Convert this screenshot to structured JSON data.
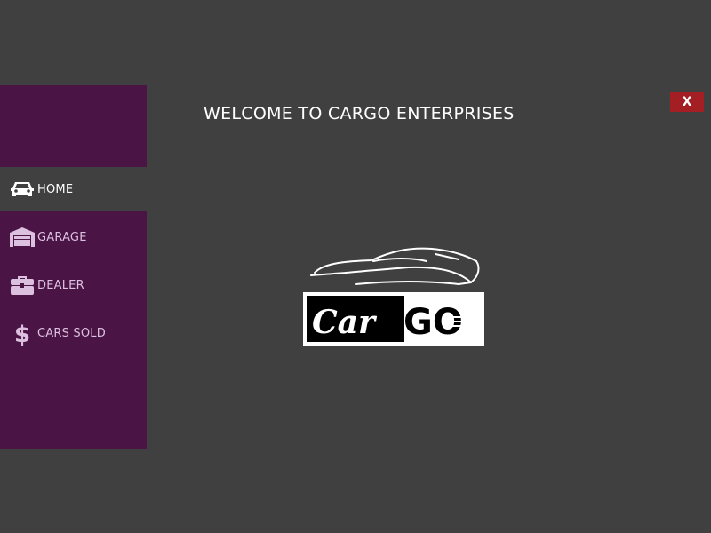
{
  "window": {
    "close_label": "X"
  },
  "header": {
    "title": "WELCOME TO CARGO ENTERPRISES"
  },
  "sidebar": {
    "items": [
      {
        "label": "HOME",
        "icon": "car-icon",
        "active": true
      },
      {
        "label": "GARAGE",
        "icon": "garage-icon",
        "active": false
      },
      {
        "label": "DEALER",
        "icon": "briefcase-icon",
        "active": false
      },
      {
        "label": "CARS SOLD",
        "icon": "dollar-icon",
        "active": false
      }
    ]
  },
  "logo": {
    "text_part1": "Car",
    "text_part2": "GO"
  },
  "colors": {
    "background": "#404040",
    "sidebar": "#4a1545",
    "close_button": "#a31f24",
    "nav_text": "#dcc0df",
    "title_text": "#ffffff"
  }
}
